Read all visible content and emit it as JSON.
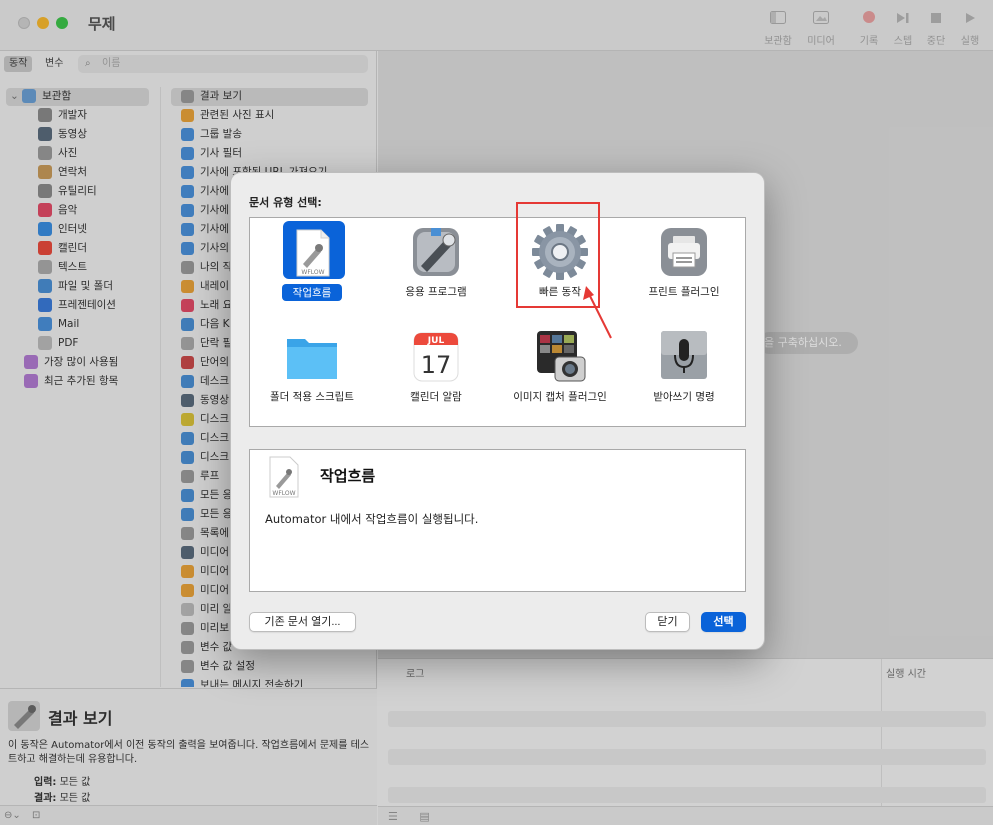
{
  "window": {
    "title": "무제"
  },
  "toolbar": [
    {
      "name": "library-toggle",
      "label": "보관함",
      "icon": "sidebar-icon"
    },
    {
      "name": "media",
      "label": "미디어",
      "icon": "photo-icon"
    },
    {
      "name": "record",
      "label": "기록",
      "icon": "record-icon"
    },
    {
      "name": "step",
      "label": "스텝",
      "icon": "step-icon"
    },
    {
      "name": "stop",
      "label": "중단",
      "icon": "stop-icon"
    },
    {
      "name": "run",
      "label": "실행",
      "icon": "play-icon"
    }
  ],
  "left_panel": {
    "tab_actions": "동작",
    "tab_variables": "변수",
    "search_placeholder": "이름",
    "library": [
      {
        "label": "보관함",
        "level": 0,
        "selected": true,
        "color": "#6a9fd4"
      },
      {
        "label": "개발자",
        "level": 1,
        "color": "#8a8a8a"
      },
      {
        "label": "동영상",
        "level": 1,
        "color": "#5a6b7d"
      },
      {
        "label": "사진",
        "level": 1,
        "color": "#9a9a9a"
      },
      {
        "label": "연락처",
        "level": 1,
        "color": "#c79a5a"
      },
      {
        "label": "유틸리티",
        "level": 1,
        "color": "#8a8a8a"
      },
      {
        "label": "음악",
        "level": 1,
        "color": "#e24b67"
      },
      {
        "label": "인터넷",
        "level": 1,
        "color": "#3a8ee0"
      },
      {
        "label": "캘린더",
        "level": 1,
        "color": "#e84a3c"
      },
      {
        "label": "텍스트",
        "level": 1,
        "color": "#aaaaaa"
      },
      {
        "label": "파일 및 폴더",
        "level": 1,
        "color": "#4a8fd4"
      },
      {
        "label": "프레젠테이션",
        "level": 1,
        "color": "#3a7ad8"
      },
      {
        "label": "Mail",
        "level": 1,
        "color": "#4a90d9"
      },
      {
        "label": "PDF",
        "level": 1,
        "color": "#bbbbbb"
      },
      {
        "label": "가장 많이 사용됨",
        "level": 0,
        "color": "#b07ad0"
      },
      {
        "label": "최근 추가된 항목",
        "level": 0,
        "color": "#b07ad0"
      }
    ],
    "actions": [
      {
        "label": "결과 보기",
        "selected": true,
        "color": "#9a9a9a"
      },
      {
        "label": "관련된 사진 표시",
        "color": "#e8a33a"
      },
      {
        "label": "그룹 발송",
        "color": "#4a90d9"
      },
      {
        "label": "기사 필터",
        "color": "#4a90d9"
      },
      {
        "label": "기사에 포함된 URL 가져오기",
        "color": "#4a90d9"
      },
      {
        "label": "기사에",
        "color": "#4a90d9"
      },
      {
        "label": "기사에",
        "color": "#4a90d9"
      },
      {
        "label": "기사에",
        "color": "#4a90d9"
      },
      {
        "label": "기사의",
        "color": "#4a90d9"
      },
      {
        "label": "나의 작",
        "color": "#9a9a9a"
      },
      {
        "label": "내레이",
        "color": "#e8a33a"
      },
      {
        "label": "노래 요",
        "color": "#e24b67"
      },
      {
        "label": "다음 K",
        "color": "#4a8fd4"
      },
      {
        "label": "단락 필",
        "color": "#aaaaaa"
      },
      {
        "label": "단어의",
        "color": "#c94a4a"
      },
      {
        "label": "데스크",
        "color": "#4a8fd4"
      },
      {
        "label": "동영상",
        "color": "#5a6b7d"
      },
      {
        "label": "디스크",
        "color": "#d8c23a"
      },
      {
        "label": "디스크",
        "color": "#4a8fd4"
      },
      {
        "label": "디스크",
        "color": "#4a8fd4"
      },
      {
        "label": "루프",
        "color": "#9a9a9a"
      },
      {
        "label": "모든 응",
        "color": "#4a8fd4"
      },
      {
        "label": "모든 응",
        "color": "#4a8fd4"
      },
      {
        "label": "목록에",
        "color": "#9a9a9a"
      },
      {
        "label": "미디어",
        "color": "#5a6b7d"
      },
      {
        "label": "미디어",
        "color": "#e8a33a"
      },
      {
        "label": "미디어",
        "color": "#e8a33a"
      },
      {
        "label": "미리 알",
        "color": "#bbbbbb"
      },
      {
        "label": "미리보",
        "color": "#9a9a9a"
      },
      {
        "label": "변수 값",
        "color": "#9a9a9a"
      },
      {
        "label": "변수 값 설정",
        "color": "#9a9a9a"
      },
      {
        "label": "보내는 메시지 전송하기",
        "color": "#4a90d9"
      }
    ],
    "description": {
      "title": "결과 보기",
      "text": "이 동작은 Automator에서 이전 동작의 출력을 보여줍니다. 작업흐름에서 문제를 테스트하고 해결하는데 유용합니다.",
      "input_label": "입력:",
      "input_value": "모든 값",
      "result_label": "결과:",
      "result_value": "모든 값"
    }
  },
  "workflow": {
    "hint": "을 구축하십시오."
  },
  "log": {
    "col_log": "로그",
    "col_duration": "실행 시간"
  },
  "dialog": {
    "heading": "문서 유형 선택:",
    "types": [
      {
        "label": "작업흐름",
        "icon": "workflow-document-icon",
        "selected": true
      },
      {
        "label": "응용 프로그램",
        "icon": "automator-app-icon"
      },
      {
        "label": "빠른 동작",
        "icon": "gear-icon"
      },
      {
        "label": "프린트 플러그인",
        "icon": "printer-icon"
      },
      {
        "label": "폴더 적용 스크립트",
        "icon": "folder-icon"
      },
      {
        "label": "캘린더 알람",
        "icon": "calendar-icon",
        "calendar_month": "JUL",
        "calendar_day": "17"
      },
      {
        "label": "이미지 캡처 플러그인",
        "icon": "image-capture-icon"
      },
      {
        "label": "받아쓰기 명령",
        "icon": "microphone-icon"
      }
    ],
    "detail": {
      "title": "작업흐름",
      "icon_caption": "WFLOW",
      "description": "Automator 내에서 작업흐름이 실행됩니다."
    },
    "btn_open": "기존 문서 열기...",
    "btn_close": "닫기",
    "btn_choose": "선택"
  },
  "colors": {
    "accent": "#0a63d9",
    "annotation": "#e53935"
  }
}
